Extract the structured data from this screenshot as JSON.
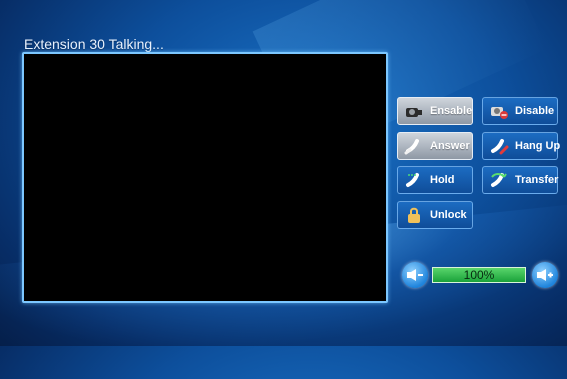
{
  "window": {
    "title": "Extension 30 Talking..."
  },
  "buttons": {
    "enable": {
      "label": "Ensable",
      "icon": "camera-icon"
    },
    "disable": {
      "label": "Disable",
      "icon": "camera-disabled-icon"
    },
    "answer": {
      "label": "Answer",
      "icon": "phone-icon"
    },
    "hangup": {
      "label": "Hang Up",
      "icon": "phone-hangup-icon"
    },
    "hold": {
      "label": "Hold",
      "icon": "phone-hold-icon"
    },
    "transfer": {
      "label": "Transfer",
      "icon": "phone-transfer-icon"
    },
    "unlock": {
      "label": "Unlock",
      "icon": "lock-icon"
    }
  },
  "volume": {
    "level": 1.0,
    "display": "100%",
    "decrease_icon": "volume-down-icon",
    "increase_icon": "volume-up-icon"
  },
  "colors": {
    "accent": "#7cc7ff",
    "volume_bar": "#36c04f",
    "disabled_button": "#aab2bc"
  }
}
